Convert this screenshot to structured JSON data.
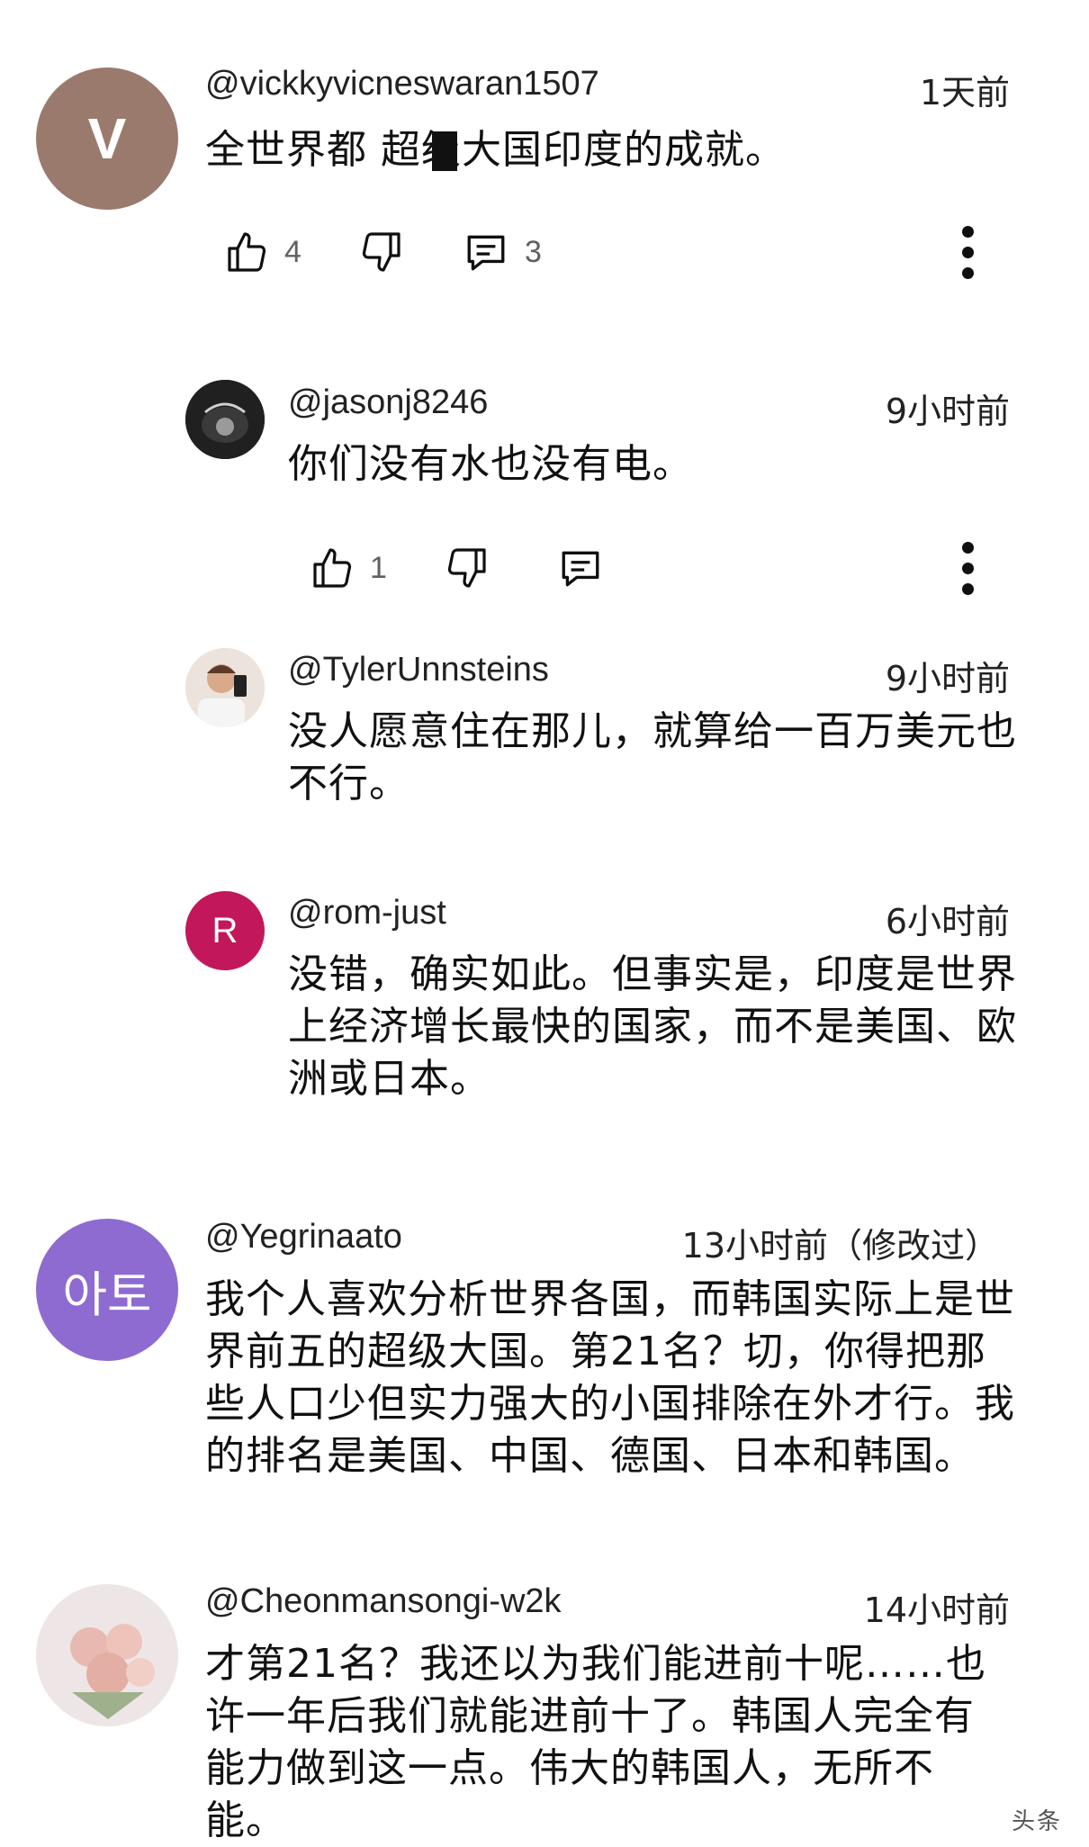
{
  "comments": [
    {
      "handle": "@vickkyvicneswaran1507",
      "time": "1天前",
      "text": "全世界都 超级大国印度的成就。",
      "avatar_letter": "V",
      "avatar_color": "#9b7a6e",
      "likes": "4",
      "replies": "3"
    },
    {
      "handle": "@jasonj8246",
      "time": "9小时前",
      "text": "你们没有水也没有电。",
      "avatar_icon": "hockey-jersey-photo",
      "likes": "1"
    },
    {
      "handle": "@TylerUnnsteins",
      "time": "9小时前",
      "text": "没人愿意住在那儿，就算给一百万美元也不行。",
      "avatar_icon": "selfie-photo"
    },
    {
      "handle": "@rom-just",
      "time": "6小时前",
      "text": "没错，确实如此。但事实是，印度是世界上经济增长最快的国家，而不是美国、欧洲或日本。",
      "avatar_letter": "R",
      "avatar_color": "#c2185b"
    },
    {
      "handle": "@Yegrinaato",
      "time": "13小时前（修改过）",
      "text": "我个人喜欢分析世界各国，而韩国实际上是世界前五的超级大国。第21名？切，你得把那些人口少但实力强大的小国排除在外才行。我的排名是美国、中国、德国、日本和韩国。",
      "avatar_letter": "아토",
      "avatar_color": "#8e6bd1"
    },
    {
      "handle": "@Cheonmansongi-w2k",
      "time": "14小时前",
      "text": "才第21名？我还以为我们能进前十呢……也许一年后我们就能进前十了。韩国人完全有能力做到这一点。伟大的韩国人，无所不能。",
      "avatar_icon": "flowers-photo"
    }
  ],
  "watermark": "头条"
}
